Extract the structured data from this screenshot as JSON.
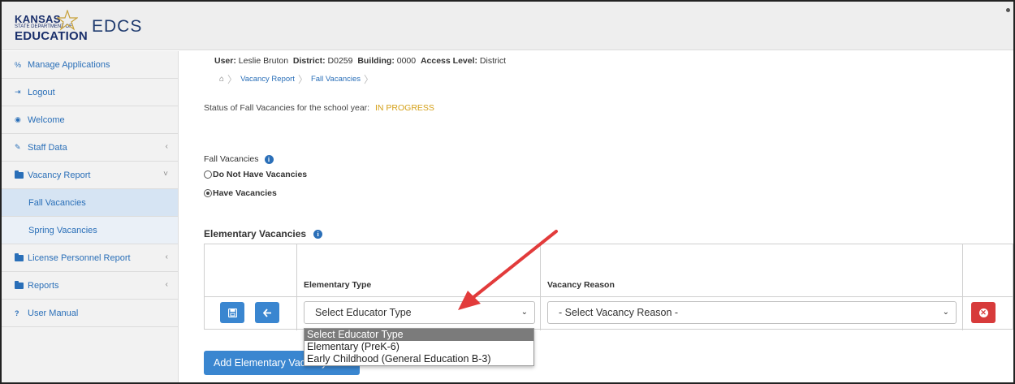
{
  "header": {
    "logo": {
      "line1": "KANSAS",
      "line2": "STATE DEPARTMENT OF",
      "line3": "EDUCATION"
    },
    "app_title": "EDCS"
  },
  "sidebar": {
    "items": [
      {
        "label": "Manage Applications",
        "icon": "sitemap-icon"
      },
      {
        "label": "Logout",
        "icon": "logout-icon"
      },
      {
        "label": "Welcome",
        "icon": "dashboard-icon"
      },
      {
        "label": "Staff Data",
        "icon": "pencil-icon",
        "chevron": "‹"
      },
      {
        "label": "Vacancy Report",
        "icon": "folder-icon",
        "chevron": "˅"
      },
      {
        "label": "Fall Vacancies",
        "sub": true,
        "active": true
      },
      {
        "label": "Spring Vacancies",
        "sub": true
      },
      {
        "label": "License Personnel Report",
        "icon": "folder-icon",
        "chevron": "‹"
      },
      {
        "label": "Reports",
        "icon": "folder-icon",
        "chevron": "‹"
      },
      {
        "label": "User Manual",
        "icon": "question-icon"
      }
    ]
  },
  "userinfo": {
    "user_label": "User:",
    "user": "Leslie Bruton",
    "district_label": "District:",
    "district": "D0259",
    "building_label": "Building:",
    "building": "0000",
    "access_label": "Access Level:",
    "access": "District"
  },
  "breadcrumb": [
    "Vacancy Report",
    "Fall Vacancies"
  ],
  "status": {
    "label": "Status of Fall Vacancies for the school year:",
    "value": "IN PROGRESS",
    "value_color": "#d4a017"
  },
  "fall_vacancies": {
    "label": "Fall Vacancies",
    "options": [
      {
        "label": "Do Not Have Vacancies",
        "checked": false
      },
      {
        "label": "Have Vacancies",
        "checked": true
      }
    ]
  },
  "elementary": {
    "title": "Elementary Vacancies",
    "col_type": "Elementary Type",
    "col_reason": "Vacancy Reason",
    "type_select": "Select Educator Type",
    "reason_select": "- Select Vacancy Reason -",
    "dropdown_options": [
      "Select Educator Type",
      "Elementary (PreK-6)",
      "Early Childhood (General Education B-3)"
    ],
    "add_button": "Add Elementary Vacancy"
  },
  "colors": {
    "accent": "#3a86d0",
    "danger": "#d73b3b",
    "annotation_arrow": "#e23b3b"
  }
}
